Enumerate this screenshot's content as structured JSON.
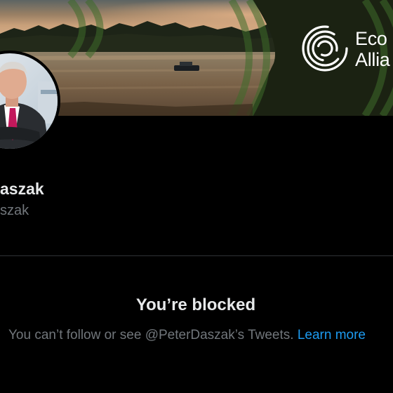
{
  "banner": {
    "brand": {
      "name_line1": "Eco",
      "name_line2": "Allia",
      "logo_icon": "concentric-rings-logo-icon"
    }
  },
  "profile": {
    "display_name": "aszak",
    "handle": "szak",
    "avatar_icon": "profile-photo-avatar"
  },
  "blocked": {
    "title": "You’re blocked",
    "message": "You can’t follow or see @PeterDaszak’s Tweets.",
    "link_label": "Learn more"
  },
  "colors": {
    "background": "#000000",
    "primary_text": "#e7e9ea",
    "secondary_text": "#71767b",
    "link": "#1d9bf0",
    "divider": "#2f3336"
  }
}
